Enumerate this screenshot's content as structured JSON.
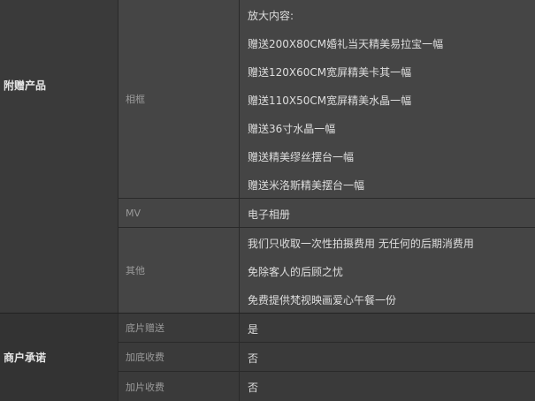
{
  "sections": [
    {
      "category": "附赠产品",
      "rows": [
        {
          "label": "相框",
          "values": [
            "放大内容:",
            "赠送200X80CM婚礼当天精美易拉宝一幅",
            "赠送120X60CM宽屏精美卡其一幅",
            "赠送110X50CM宽屏精美水晶一幅",
            "赠送36寸水晶一幅",
            "赠送精美缪丝摆台一幅",
            "赠送米洛斯精美摆台一幅"
          ]
        },
        {
          "label": "MV",
          "values": [
            "电子相册"
          ]
        },
        {
          "label": "其他",
          "values": [
            "我们只收取一次性拍摄费用 无任何的后期消费用",
            "免除客人的后顾之忧",
            "免费提供梵视映画爱心午餐一份"
          ]
        }
      ]
    },
    {
      "category": "商户承诺",
      "rows": [
        {
          "label": "底片赠送",
          "values": [
            "是"
          ]
        },
        {
          "label": "加底收费",
          "values": [
            "否"
          ]
        },
        {
          "label": "加片收费",
          "values": [
            "否"
          ]
        }
      ]
    }
  ]
}
